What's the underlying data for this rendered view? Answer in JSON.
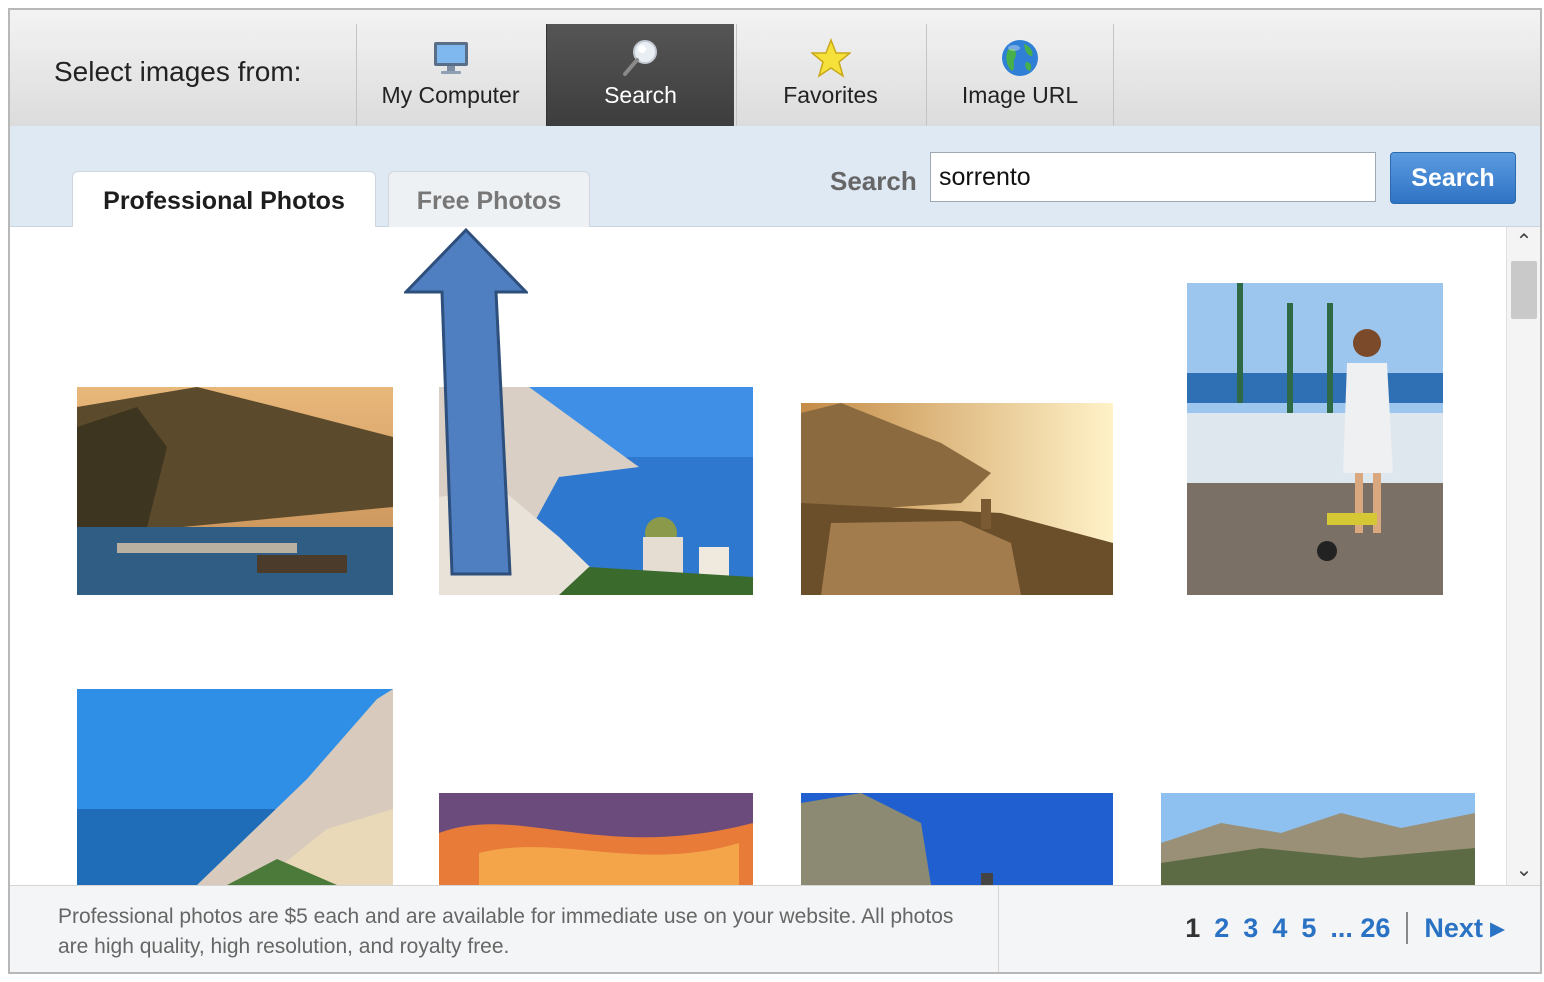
{
  "source_bar": {
    "label": "Select images from:",
    "tabs": [
      {
        "label": "My Computer",
        "icon": "computer-monitor-icon"
      },
      {
        "label": "Search",
        "icon": "magnifier-icon",
        "active": true
      },
      {
        "label": "Favorites",
        "icon": "star-icon"
      },
      {
        "label": "Image URL",
        "icon": "globe-icon"
      }
    ]
  },
  "photo_tabs": [
    {
      "label": "Professional Photos",
      "active": true
    },
    {
      "label": "Free Photos",
      "active": false
    }
  ],
  "search": {
    "label": "Search",
    "value": "sorrento",
    "button": "Search"
  },
  "footer": {
    "note": "Professional photos are $5 each and are available for immediate use on your website. All photos are high quality, high resolution, and royalty free."
  },
  "pagination": {
    "current": "1",
    "pages": [
      "2",
      "3",
      "4",
      "5"
    ],
    "ellipsis_last": "... 26",
    "next": "Next ▸"
  },
  "colors": {
    "accent": "#2a72c4",
    "arrow": "#4f7fc0"
  }
}
